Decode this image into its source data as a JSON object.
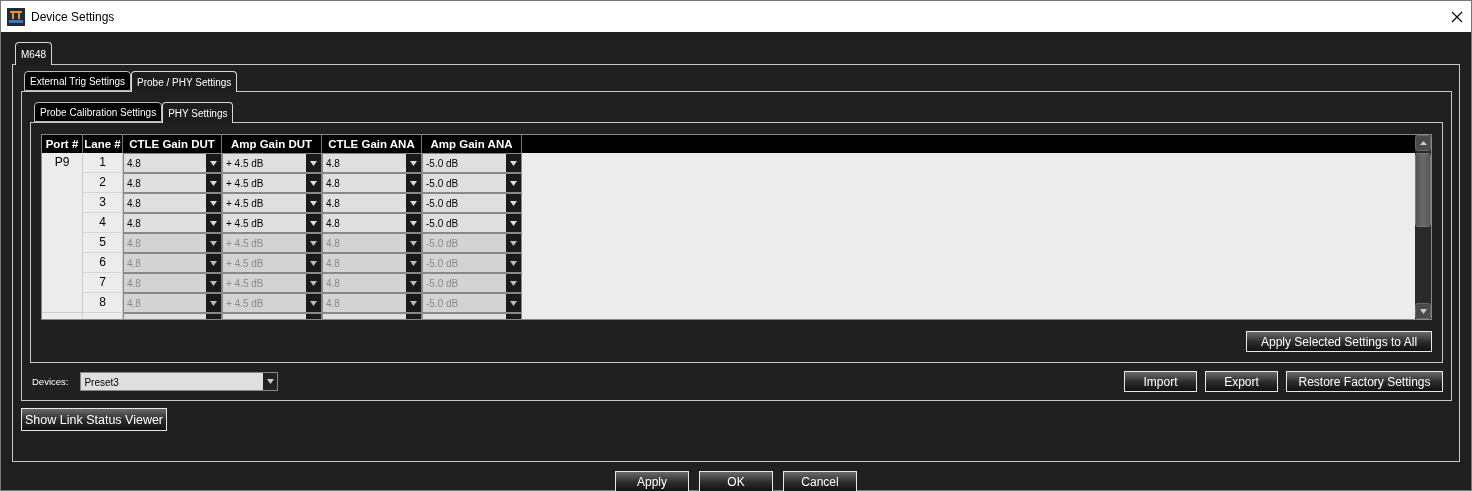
{
  "window": {
    "title": "Device Settings"
  },
  "device_tabs": [
    {
      "label": "M648",
      "selected": true
    }
  ],
  "settings_tabs": [
    {
      "label": "External Trig Settings",
      "selected": false
    },
    {
      "label": "Probe / PHY Settings",
      "selected": true
    }
  ],
  "probe_tabs": [
    {
      "label": "Probe Calibration Settings",
      "selected": false
    },
    {
      "label": "PHY Settings",
      "selected": true
    }
  ],
  "table": {
    "columns": [
      "Port #",
      "Lane #",
      "CTLE Gain DUT",
      "Amp Gain DUT",
      "CTLE Gain ANA",
      "Amp Gain ANA"
    ],
    "ports": [
      {
        "port": "P9",
        "lanes": [
          {
            "lane": "1",
            "enabled": true,
            "values": [
              "4.8",
              "+ 4.5 dB",
              "4.8",
              "-5.0 dB"
            ]
          },
          {
            "lane": "2",
            "enabled": true,
            "values": [
              "4.8",
              "+ 4.5 dB",
              "4.8",
              "-5.0 dB"
            ]
          },
          {
            "lane": "3",
            "enabled": true,
            "values": [
              "4.8",
              "+ 4.5 dB",
              "4.8",
              "-5.0 dB"
            ]
          },
          {
            "lane": "4",
            "enabled": true,
            "values": [
              "4.8",
              "+ 4.5 dB",
              "4.8",
              "-5.0 dB"
            ]
          },
          {
            "lane": "5",
            "enabled": false,
            "values": [
              "4.8",
              "+ 4.5 dB",
              "4.8",
              "-5.0 dB"
            ]
          },
          {
            "lane": "6",
            "enabled": false,
            "values": [
              "4.8",
              "+ 4.5 dB",
              "4.8",
              "-5.0 dB"
            ]
          },
          {
            "lane": "7",
            "enabled": false,
            "values": [
              "4.8",
              "+ 4.5 dB",
              "4.8",
              "-5.0 dB"
            ]
          },
          {
            "lane": "8",
            "enabled": false,
            "values": [
              "4.8",
              "+ 4.5 dB",
              "4.8",
              "-5.0 dB"
            ]
          }
        ]
      }
    ]
  },
  "apply_all_button": "Apply Selected Settings to All",
  "devices": {
    "label": "Devices:",
    "value": "Preset3"
  },
  "file_buttons": [
    "Import",
    "Export",
    "Restore Factory Settings"
  ],
  "link_status_button": "Show Link Status Viewer",
  "dialog_buttons": [
    "Apply",
    "OK",
    "Cancel"
  ]
}
